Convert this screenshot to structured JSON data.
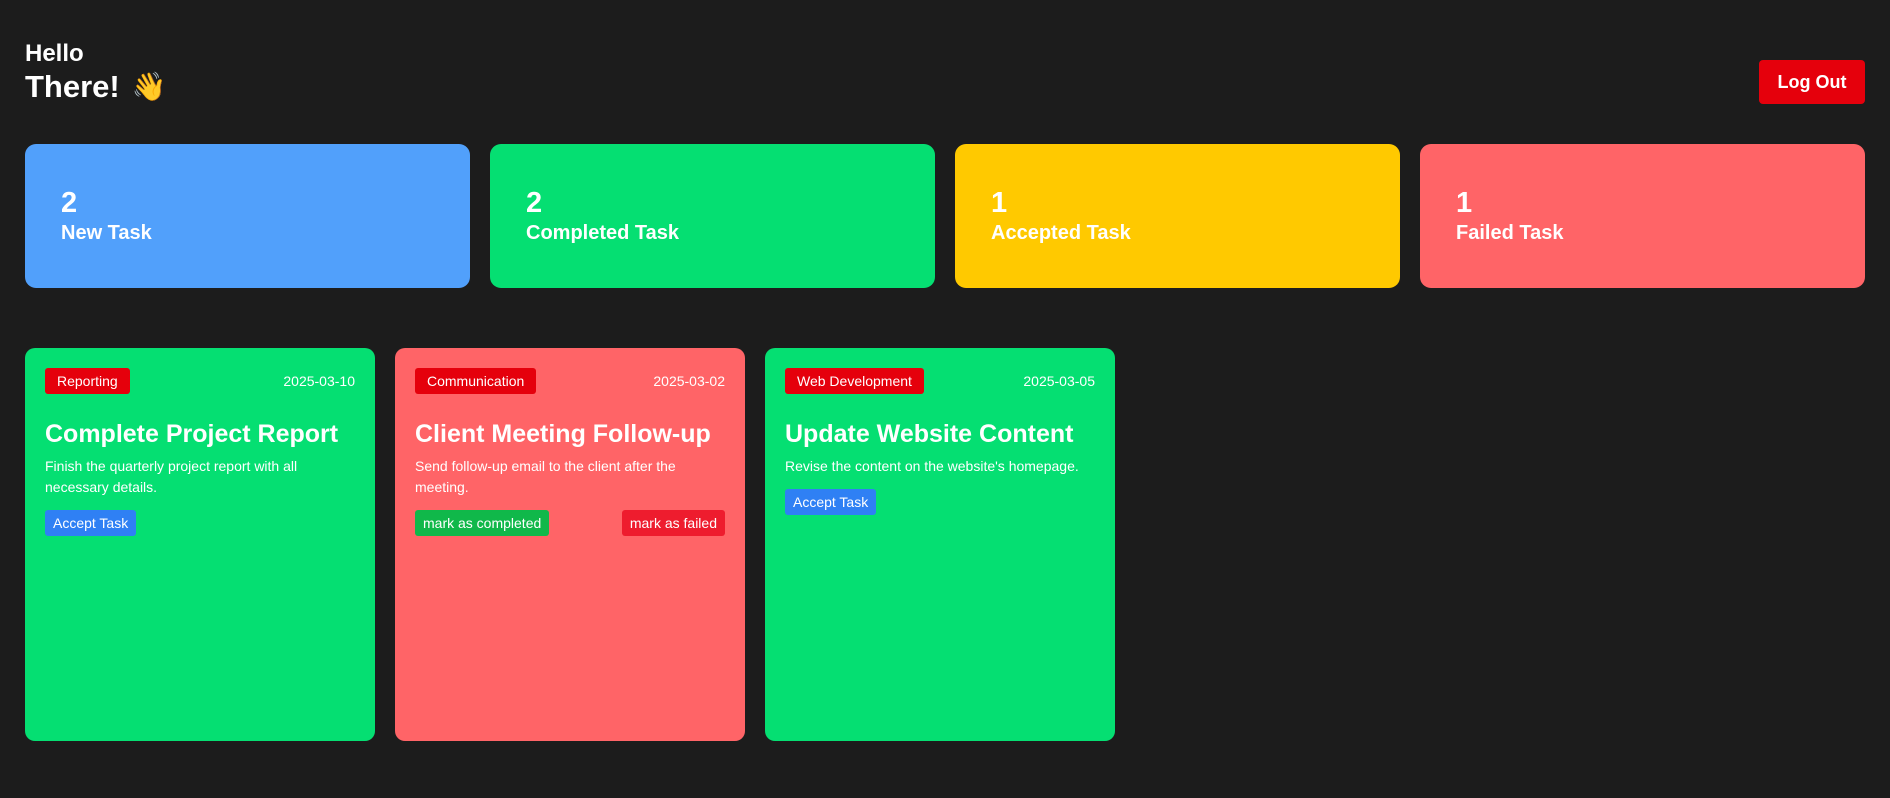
{
  "header": {
    "greeting": "Hello",
    "name": "There!",
    "wave_emoji": "👋",
    "logout_label": "Log Out"
  },
  "stats": [
    {
      "count": "2",
      "label": "New Task",
      "color": "#51a0fb"
    },
    {
      "count": "2",
      "label": "Completed Task",
      "color": "#05df72"
    },
    {
      "count": "1",
      "label": "Accepted Task",
      "color": "#ffc900"
    },
    {
      "count": "1",
      "label": "Failed Task",
      "color": "#ff6467"
    }
  ],
  "tasks": [
    {
      "category": "Reporting",
      "date": "2025-03-10",
      "title": "Complete Project Report",
      "description": "Finish the quarterly project report with all necessary details.",
      "bg_color": "#05df72",
      "accept_label": "Accept Task"
    },
    {
      "category": "Communication",
      "date": "2025-03-02",
      "title": "Client Meeting Follow-up",
      "description": "Send follow-up email to the client after the meeting.",
      "bg_color": "#ff6467",
      "complete_label": "mark as completed",
      "fail_label": "mark as failed"
    },
    {
      "category": "Web Development",
      "date": "2025-03-05",
      "title": "Update Website Content",
      "description": "Revise the content on the website's homepage.",
      "bg_color": "#05df72",
      "accept_label": "Accept Task"
    }
  ]
}
